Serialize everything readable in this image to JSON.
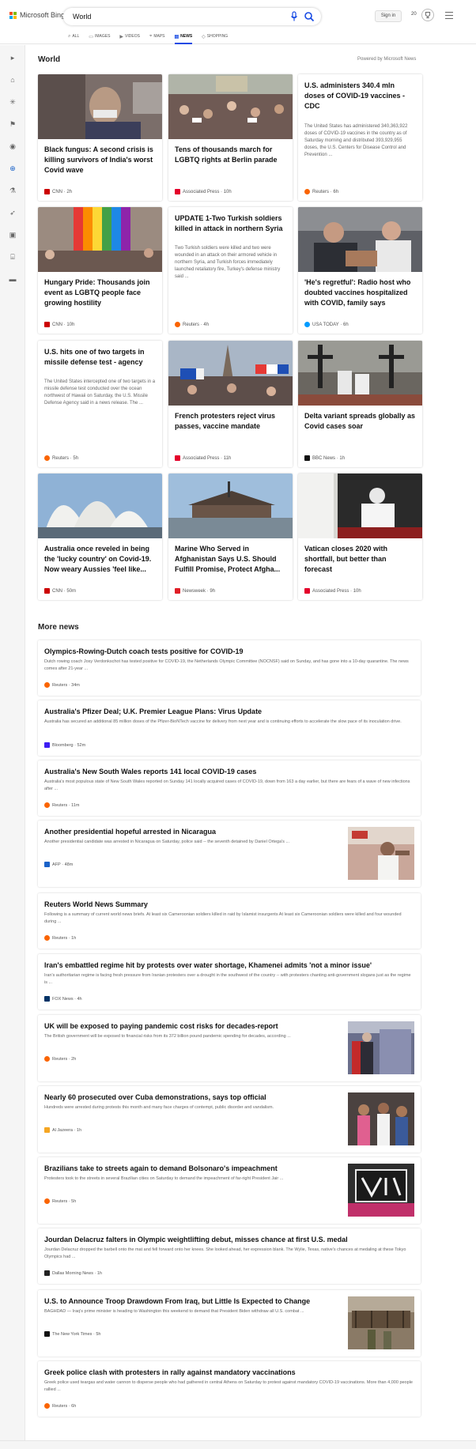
{
  "header": {
    "brand": "Microsoft Bing",
    "search_value": "World",
    "signin_label": "Sign in",
    "points": "20",
    "tabs": [
      {
        "label": "ALL",
        "icon": "search-icon"
      },
      {
        "label": "IMAGES",
        "icon": "image-icon"
      },
      {
        "label": "VIDEOS",
        "icon": "video-icon"
      },
      {
        "label": "MAPS",
        "icon": "map-pin-icon"
      },
      {
        "label": "NEWS",
        "icon": "news-icon",
        "active": true
      },
      {
        "label": "SHOPPING",
        "icon": "tag-icon"
      }
    ],
    "colors": {
      "accent": "#174ae4",
      "logo": [
        "#f25022",
        "#7fba00",
        "#00a4ef",
        "#ffb900"
      ]
    }
  },
  "rail": {
    "items": [
      "expand-icon",
      "home-icon",
      "coronavirus-icon",
      "flag-icon",
      "location-icon",
      "globe-icon",
      "science-icon",
      "rocket-icon",
      "entertainment-icon",
      "business-icon",
      "money-icon"
    ],
    "active_index": 5
  },
  "world": {
    "title": "World",
    "powered_by": "Powered by Microsoft News",
    "cards": [
      {
        "title": "Black fungus: A second crisis is killing survivors of India's worst Covid wave",
        "provider": "CNN",
        "time": "2h",
        "logo_color": "#cc0000"
      },
      {
        "title": "Tens of thousands march for LGBTQ rights at Berlin parade",
        "provider": "Associated Press",
        "time": "10h",
        "logo_color": "#e4002b"
      },
      {
        "title": "U.S. administers 340.4 mln doses of COVID-19 vaccines - CDC",
        "snippet": "The United States has administered 340,363,922 doses of COVID-19 vaccines in the country as of Saturday morning and distributed 393,929,955 doses, the U.S. Centers for Disease Control and Prevention ...",
        "provider": "Reuters",
        "time": "6h",
        "logo_color": "#fa6400"
      },
      {
        "title": "Hungary Pride: Thousands join event as LGBTQ people face growing hostility",
        "provider": "CNN",
        "time": "10h",
        "logo_color": "#cc0000"
      },
      {
        "title": "UPDATE 1-Two Turkish soldiers killed in attack in northern Syria",
        "snippet": "Two Turkish soldiers were killed and two were wounded in an attack on their armored vehicle in northern Syria, and Turkish forces immediately launched retaliatory fire, Turkey's defense ministry said ...",
        "provider": "Reuters",
        "time": "4h",
        "logo_color": "#fa6400"
      },
      {
        "title": "'He's regretful': Radio host who doubted vaccines hospitalized with COVID, family says",
        "provider": "USA TODAY",
        "time": "6h",
        "logo_color": "#009bff"
      },
      {
        "title": "U.S. hits one of two targets in missile defense test - agency",
        "snippet": "The United States intercepted one of two targets in a missile defense test conducted over the ocean northwest of Hawaii on Saturday, the U.S. Missile Defense Agency said in a news release. The ...",
        "provider": "Reuters",
        "time": "5h",
        "logo_color": "#fa6400"
      },
      {
        "title": "French protesters reject virus passes, vaccine mandate",
        "provider": "Associated Press",
        "time": "11h",
        "logo_color": "#e4002b"
      },
      {
        "title": "Delta variant spreads globally as Covid cases soar",
        "provider": "BBC News",
        "time": "1h",
        "logo_color": "#111111"
      },
      {
        "title": "Australia once reveled in being the 'lucky country' on Covid-19. Now weary Aussies 'feel like...",
        "provider": "CNN",
        "time": "50m",
        "logo_color": "#cc0000"
      },
      {
        "title": "Marine Who Served in Afghanistan Says U.S. Should Fulfill Promise, Protect Afgha...",
        "provider": "Newsweek",
        "time": "9h",
        "logo_color": "#e01e26"
      },
      {
        "title": "Vatican closes 2020 with shortfall, but better than forecast",
        "provider": "Associated Press",
        "time": "10h",
        "logo_color": "#e4002b"
      }
    ]
  },
  "more_news": {
    "title": "More news",
    "items": [
      {
        "title": "Olympics-Rowing-Dutch coach tests positive for COVID-19",
        "snippet": "Dutch rowing coach Josy Verdonkschot has tested positive for COVID-19, the Netherlands Olympic Committee (NOCNSF) said on Sunday, and has gone into a 10-day quarantine. The news comes after 21-year ...",
        "provider": "Reuters",
        "time": "34m",
        "logo_color": "#fa6400"
      },
      {
        "title": "Australia's Pfizer Deal; U.K. Premier League Plans: Virus Update",
        "snippet": "Australia has secured an additional 85 million doses of the Pfizer-BioNTech vaccine for delivery from next year and is continuing efforts to accelerate the slow pace of its inoculation drive.",
        "provider": "Bloomberg",
        "time": "52m",
        "logo_color": "#3d1df3"
      },
      {
        "title": "Australia's New South Wales reports 141 local COVID-19 cases",
        "snippet": "Australia's most populous state of New South Wales reported on Sunday 141 locally acquired cases of COVID-19, down from 163 a day earlier, but there are fears of a wave of new infections after ...",
        "provider": "Reuters",
        "time": "11m",
        "logo_color": "#fa6400"
      },
      {
        "title": "Another presidential hopeful arrested in Nicaragua",
        "snippet": "Another presidential candidate was arrested in Nicaragua on Saturday, police said -- the seventh detained by Daniel Ortega's ...",
        "provider": "AFP",
        "time": "48m",
        "logo_color": "#1a62c8",
        "thumb": true
      },
      {
        "title": "Reuters World News Summary",
        "snippet": "Following is a summary of current world news briefs. At least six Cameroonian soldiers killed in raid by Islamist insurgents At least six Cameroonian soldiers were killed and four wounded during ...",
        "provider": "Reuters",
        "time": "1h",
        "logo_color": "#fa6400"
      },
      {
        "title": "Iran's embattled regime hit by protests over water shortage, Khamenei admits 'not a minor issue'",
        "snippet": "Iran's authoritarian regime is facing fresh pressure from Iranian protesters over a drought in the southwest of the country -- with protesters chanting anti-government slogans just as the regime is ...",
        "provider": "FOX News",
        "time": "4h",
        "logo_color": "#003366"
      },
      {
        "title": "UK will be exposed to paying pandemic cost risks for decades-report",
        "snippet": "The British government will be exposed to financial risks from its 372 billion pound pandemic spending for decades, according ...",
        "provider": "Reuters",
        "time": "2h",
        "logo_color": "#fa6400",
        "thumb": true
      },
      {
        "title": "Nearly 60 prosecuted over Cuba demonstrations, says top official",
        "snippet": "Hundreds were arrested during protests this month and many face charges of contempt, public disorder and vandalism.",
        "provider": "Al Jazeera",
        "time": "1h",
        "logo_color": "#f5a623",
        "thumb": true
      },
      {
        "title": "Brazilians take to streets again to demand Bolsonaro's impeachment",
        "snippet": "Protesters took to the streets in several Brazilian cities on Saturday to demand the impeachment of far-right President Jair ...",
        "provider": "Reuters",
        "time": "5h",
        "logo_color": "#fa6400",
        "thumb": true
      },
      {
        "title": "Jourdan Delacruz falters in Olympic weightlifting debut, misses chance at first U.S. medal",
        "snippet": "Jourdan Delacruz dropped the barbell onto the mat and fell forward onto her knees. She looked ahead, her expression blank. The Wylie, Texas, native's chances at medaling at these Tokyo Olympics had ...",
        "provider": "Dallas Morning News",
        "time": "1h",
        "logo_color": "#222222"
      },
      {
        "title": "U.S. to Announce Troop Drawdown From Iraq, but Little Is Expected to Change",
        "snippet": "BAGHDAD — Iraq's prime minister is heading to Washington this weekend to demand that President Biden withdraw all U.S. combat ...",
        "provider": "The New York Times",
        "time": "5h",
        "logo_color": "#111111",
        "thumb": true
      },
      {
        "title": "Greek police clash with protesters in rally against mandatory vaccinations",
        "snippet": "Greek police used teargas and water cannon to disperse people who had gathered in central Athens on Saturday to protest against mandatory COVID-19 vaccinations. More than 4,000 people rallied ...",
        "provider": "Reuters",
        "time": "6h",
        "logo_color": "#fa6400"
      }
    ]
  }
}
